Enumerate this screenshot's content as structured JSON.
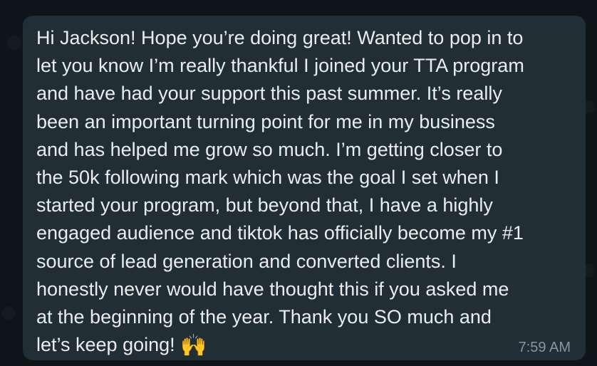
{
  "message": {
    "lines": [
      "Hi Jackson! Hope you’re doing great! Wanted to pop in to",
      "let you know I’m really thankful I joined your TTA program",
      "and have had your support this past summer. It’s really",
      "been an important turning point for me in my business",
      "and has helped me grow so much. I’m getting closer to",
      "the 50k following mark which was the goal I set when I",
      "started your program, but beyond that, I have a highly",
      "engaged audience and tiktok has officially become my #1",
      "source of lead generation and converted clients. I",
      "honestly never would have thought this if you asked me",
      "at the beginning of the year. Thank you SO much and",
      "let’s keep going! "
    ],
    "emoji": "🙌",
    "emoji_name": "raising-hands-icon",
    "time": "7:59 AM"
  },
  "colors": {
    "background": "#0e1519",
    "bubble": "#222e35",
    "text": "#e9edef",
    "time": "#8696a0"
  }
}
